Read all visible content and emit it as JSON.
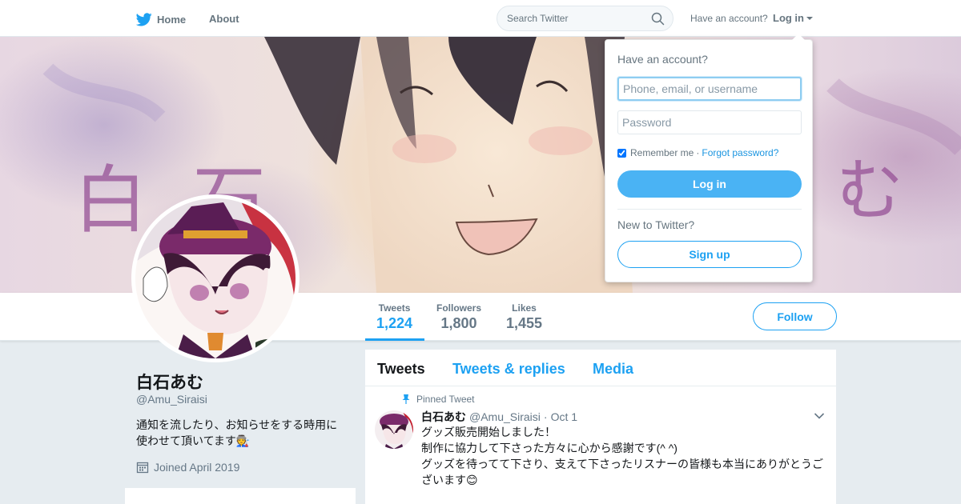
{
  "nav": {
    "home_label": "Home",
    "about_label": "About",
    "search_placeholder": "Search Twitter",
    "have_account": "Have an account?",
    "login_label": "Log in",
    "twitter_icon": "twitter-bird-icon",
    "search_icon": "search-icon",
    "brand_color": "#1da1f2"
  },
  "banner": {
    "left_text_1": "白",
    "left_text_2": "石",
    "right_text": "む"
  },
  "profile_nav": {
    "stats": [
      {
        "label": "Tweets",
        "value": "1,224"
      },
      {
        "label": "Followers",
        "value": "1,800"
      },
      {
        "label": "Likes",
        "value": "1,455"
      }
    ],
    "follow_label": "Follow"
  },
  "profile": {
    "name": "白石あむ",
    "handle": "@Amu_Siraisi",
    "bio_line1": "通知を流したり、お知らせをする時用に",
    "bio_line2": "使わせて頂いてます🧑‍🏭",
    "joined": "Joined April 2019",
    "calendar_icon": "calendar-icon"
  },
  "timeline": {
    "tabs": [
      "Tweets",
      "Tweets & replies",
      "Media"
    ],
    "pinned_label": "Pinned Tweet",
    "tweet": {
      "name": "白石あむ",
      "handle": "@Amu_Siraisi",
      "separator": "·",
      "time": "Oct 1",
      "lines": [
        "グッズ販売開始しました！",
        "制作に協力して下さった方々に心から感謝です(^ ^)",
        "グッズを待ってて下さり、支えて下さったリスナーの皆様も本当にありがとうご",
        "ざいます😊"
      ]
    }
  },
  "login_dropdown": {
    "title": "Have an account?",
    "username_placeholder": "Phone, email, or username",
    "password_placeholder": "Password",
    "remember_label": "Remember me",
    "separator": "·",
    "forgot_label": "Forgot password?",
    "login_button": "Log in",
    "new_label": "New to Twitter?",
    "signup_button": "Sign up"
  }
}
